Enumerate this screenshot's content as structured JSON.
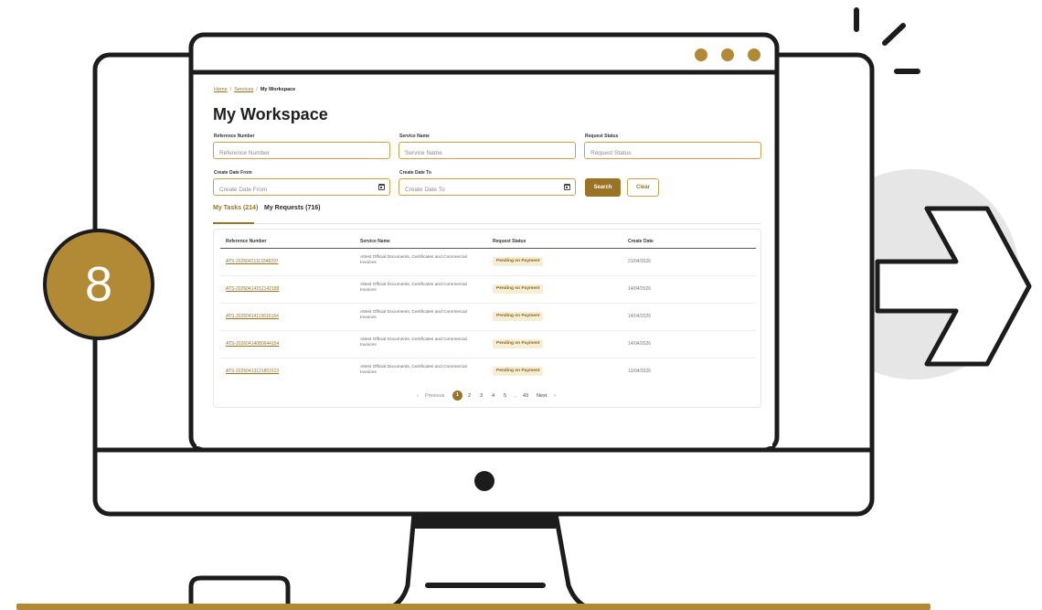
{
  "step": {
    "number": "8"
  },
  "breadcrumb": {
    "home": "Home",
    "services": "Services",
    "current": "My Workspace",
    "separator": "/"
  },
  "page": {
    "title": "My Workspace"
  },
  "filters": {
    "reference_number": {
      "label": "Reference Number",
      "placeholder": "Reference Number"
    },
    "service_name": {
      "label": "Service Name",
      "placeholder": "Service Name"
    },
    "request_status": {
      "label": "Request Status",
      "placeholder": "Request Status"
    },
    "create_date_from": {
      "label": "Create Date From",
      "placeholder": "Create Date From"
    },
    "create_date_to": {
      "label": "Create Date To",
      "placeholder": "Create Date To"
    },
    "search_label": "Search",
    "clear_label": "Clear"
  },
  "tabs": [
    {
      "label": "My Tasks (214)",
      "active": true
    },
    {
      "label": "My Requests (716)",
      "active": false
    }
  ],
  "table": {
    "headers": [
      "Reference Number",
      "Service Name",
      "Request Status",
      "Create Date"
    ],
    "rows": [
      {
        "ref": "ATS-20260421113348297",
        "service": "Attest Official Documents, Certificates and Commercial Invoices",
        "status": "Pending on Payment",
        "date": "21/04/2026"
      },
      {
        "ref": "ATS-20260414152142188",
        "service": "Attest Official Documents, Certificates and Commercial Invoices",
        "status": "Pending on Payment",
        "date": "14/04/2026"
      },
      {
        "ref": "ATS-20260414115616164",
        "service": "Attest Official Documents, Certificates and Commercial Invoices",
        "status": "Pending on Payment",
        "date": "14/04/2026"
      },
      {
        "ref": "ATS-20260414080644154",
        "service": "Attest Official Documents, Certificates and Commercial Invoices",
        "status": "Pending on Payment",
        "date": "14/04/2026"
      },
      {
        "ref": "ATS-20260413121853123",
        "service": "Attest Official Documents, Certificates and Commercial Invoices",
        "status": "Pending on Payment",
        "date": "13/04/2026"
      }
    ]
  },
  "pagination": {
    "previous": "Previous",
    "next": "Next",
    "pages": [
      "1",
      "2",
      "3",
      "4",
      "5"
    ],
    "ellipsis": "...",
    "last": "43",
    "current": "1"
  },
  "colors": {
    "accent": "#9a7424",
    "accent_light": "#c9a24a",
    "badge_gold": "#b28935",
    "outline": "#1c1c1c",
    "deco_gray": "#e6e6e6"
  },
  "icons": [
    "calendar-icon",
    "chevron-left-icon",
    "chevron-right-icon",
    "window-dot-icon",
    "arrow-chevron-icon"
  ]
}
